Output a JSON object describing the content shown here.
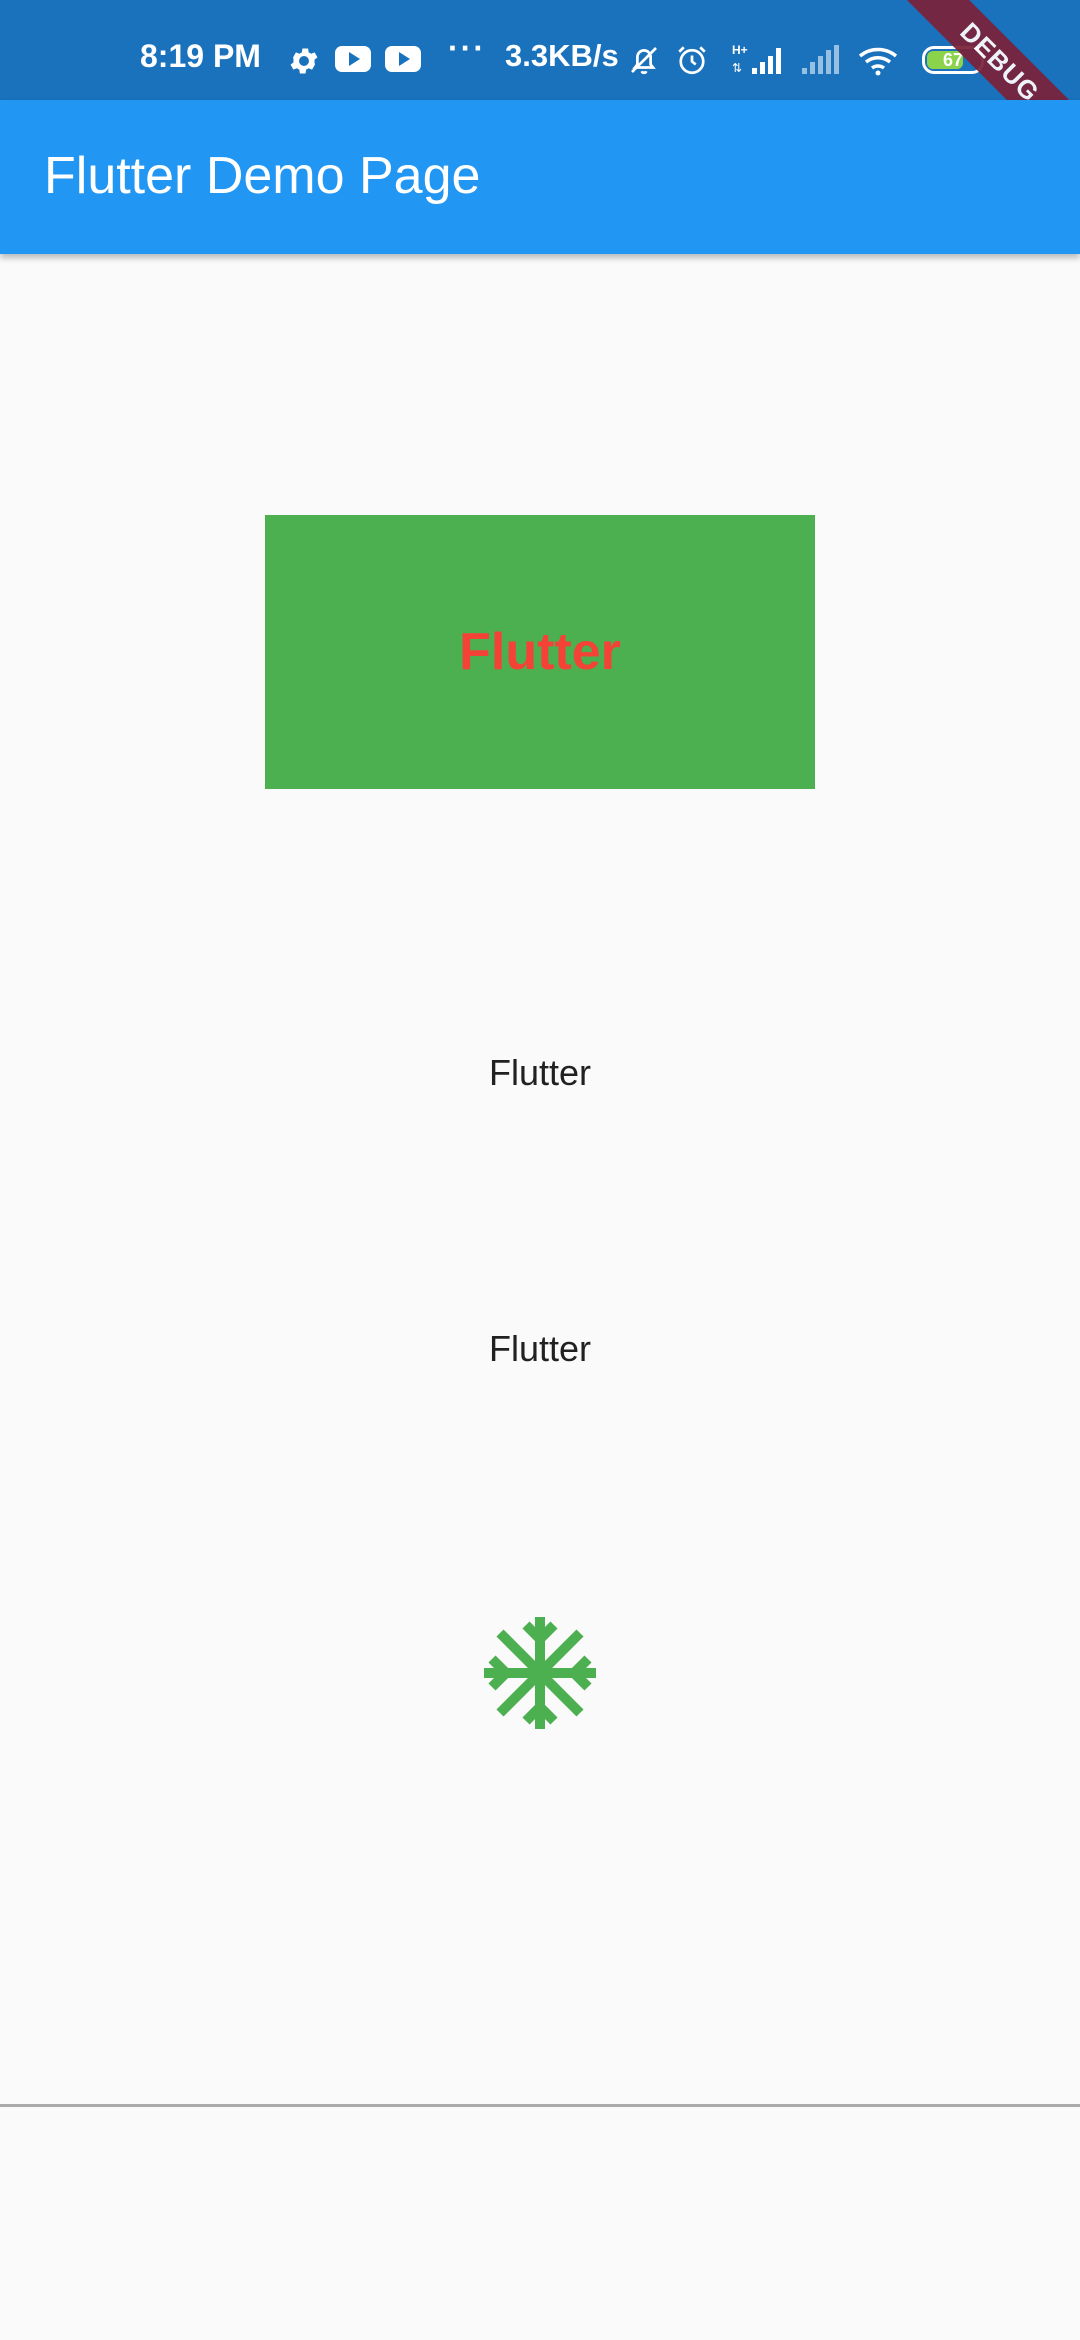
{
  "status_bar": {
    "time": "8:19 PM",
    "speed": "3.3KB/s",
    "more": "···",
    "battery_level": "67",
    "icons": [
      "gear-icon",
      "youtube-icon",
      "youtube-icon",
      "mute-bell-icon",
      "alarm-icon",
      "hplus-signal-icon",
      "signal-icon",
      "wifi-icon",
      "battery-icon"
    ]
  },
  "debug_banner": "DEBUG",
  "app_bar": {
    "title": "Flutter Demo Page"
  },
  "content": {
    "box_label": "Flutter",
    "text_1": "Flutter",
    "text_2": "Flutter",
    "icon": "ac-unit-icon"
  },
  "colors": {
    "status_bar": "#1a72bd",
    "app_bar": "#2196f3",
    "box": "#4caf50",
    "box_text": "#f44336",
    "icon": "#4caf50",
    "background": "#fafafa"
  }
}
